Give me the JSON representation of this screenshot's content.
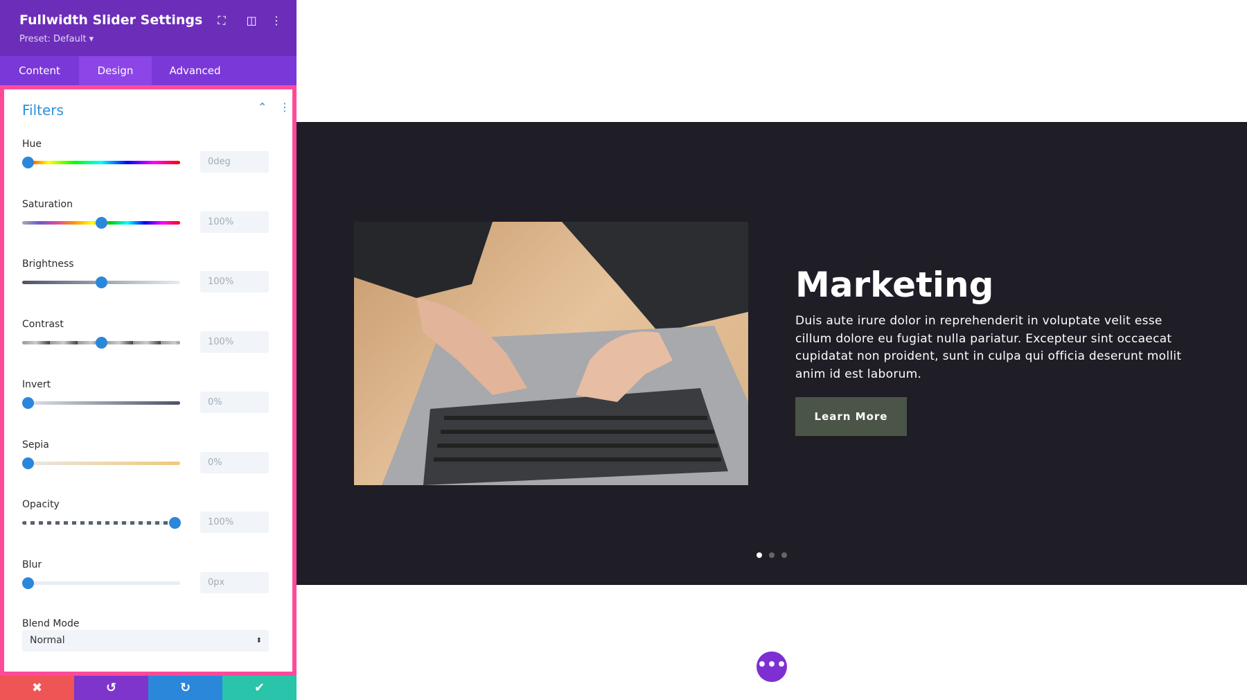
{
  "panel": {
    "title": "Fullwidth Slider Settings",
    "preset": "Preset: Default ▾",
    "header_icons": [
      "focus-icon",
      "split-view-icon",
      "more-vertical-icon"
    ],
    "tabs": [
      {
        "label": "Content"
      },
      {
        "label": "Design",
        "active": true
      },
      {
        "label": "Advanced"
      }
    ],
    "section": {
      "title": "Filters",
      "expanded": true
    },
    "filters": [
      {
        "label": "Hue",
        "value": "0deg",
        "position": 0
      },
      {
        "label": "Saturation",
        "value": "100%",
        "position": 0.5
      },
      {
        "label": "Brightness",
        "value": "100%",
        "position": 0.5
      },
      {
        "label": "Contrast",
        "value": "100%",
        "position": 0.5
      },
      {
        "label": "Invert",
        "value": "0%",
        "position": 0
      },
      {
        "label": "Sepia",
        "value": "0%",
        "position": 0
      },
      {
        "label": "Opacity",
        "value": "100%",
        "position": 1
      },
      {
        "label": "Blur",
        "value": "0px",
        "position": 0
      }
    ],
    "blend_mode": {
      "label": "Blend Mode",
      "value": "Normal"
    },
    "actions": {
      "cancel": "✖",
      "undo": "↺",
      "redo": "↻",
      "save": "✔"
    },
    "colors": {
      "header": "#6c2eb9",
      "tabs": "#7b38d8",
      "highlight": "#ff4a9a",
      "accent": "#2b87da",
      "cancel": "#ef5554",
      "undo": "#7d35cc",
      "redo": "#2b87da",
      "save": "#29c4a9"
    }
  },
  "slide": {
    "heading": "Marketing",
    "body": "Duis aute irure dolor in reprehenderit in voluptate velit esse cillum dolore eu fugiat nulla pariatur. Excepteur sint occaecat cupidatat non proident, sunt in culpa qui officia deserunt mollit anim id est laborum.",
    "button": "Learn More",
    "active_dot": 0,
    "dot_count": 3,
    "background": "#1f1e26",
    "button_color": "#4b5547"
  },
  "fab": "•••"
}
